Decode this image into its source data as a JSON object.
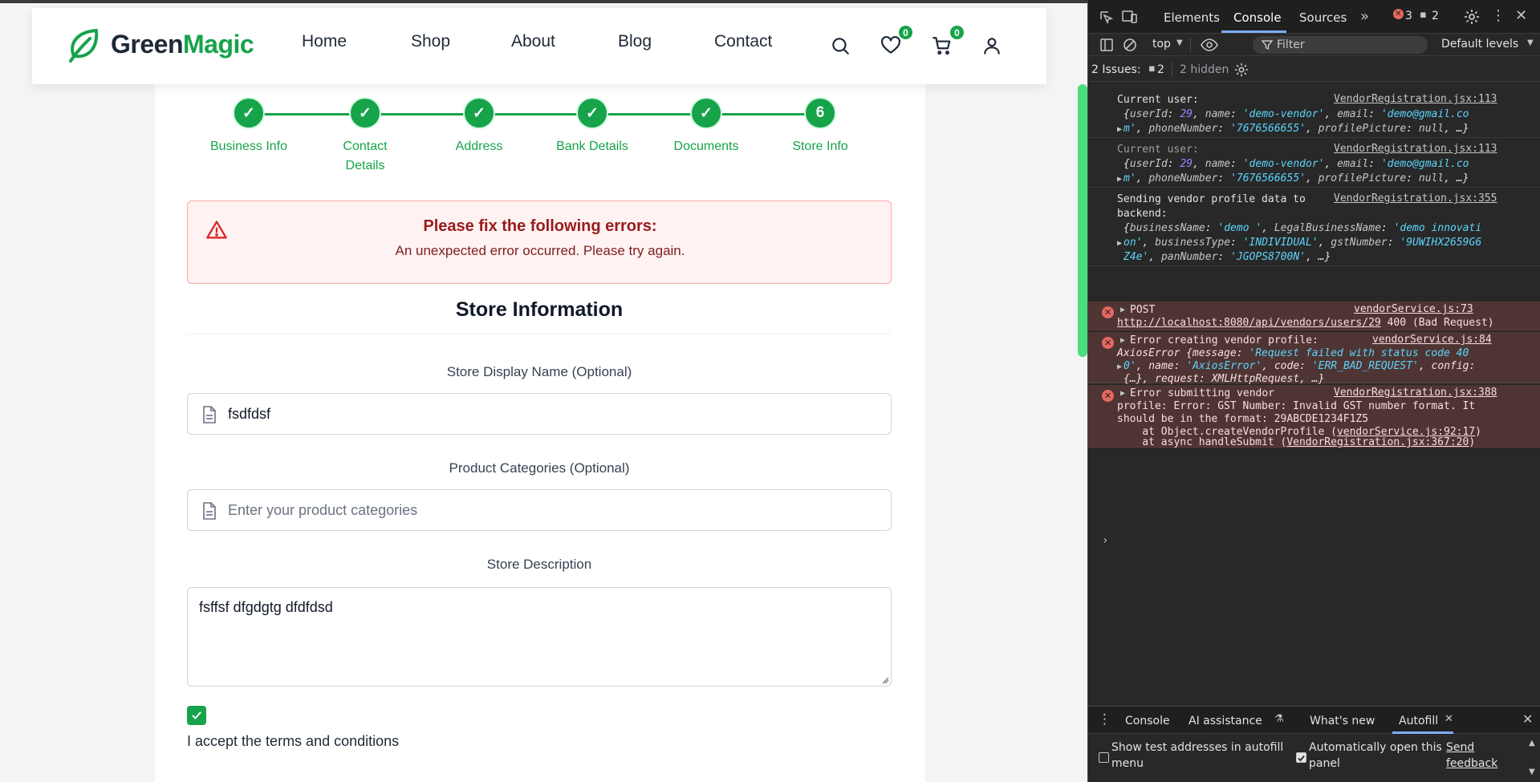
{
  "header": {
    "brand_part1": "Green",
    "brand_part2": "Magic",
    "nav": [
      "Home",
      "Shop",
      "About",
      "Blog",
      "Contact"
    ],
    "wishlist_count": "0",
    "cart_count": "0"
  },
  "stepper": {
    "steps": [
      {
        "label": "Business Info",
        "marker": "✓"
      },
      {
        "label": "Contact Details",
        "marker": "✓"
      },
      {
        "label": "Address",
        "marker": "✓"
      },
      {
        "label": "Bank Details",
        "marker": "✓"
      },
      {
        "label": "Documents",
        "marker": "✓"
      },
      {
        "label": "Store Info",
        "marker": "6"
      }
    ]
  },
  "error": {
    "title": "Please fix the following errors:",
    "message": "An unexpected error occurred. Please try again."
  },
  "form": {
    "section_title": "Store Information",
    "display_name_label": "Store Display Name (Optional)",
    "display_name_value": "fsdfdsf",
    "categories_label": "Product Categories (Optional)",
    "categories_placeholder": "Enter your product categories",
    "categories_value": "",
    "description_label": "Store Description",
    "description_value": "fsffsf dfgdgtg dfdfdsd",
    "terms_label": "I accept the terms and conditions",
    "terms_checked": true
  },
  "devtools": {
    "tabs": [
      "Elements",
      "Console",
      "Sources"
    ],
    "active_tab": "Console",
    "error_count": "3",
    "message_count": "2",
    "context": "top",
    "filter_placeholder": "Filter",
    "levels": "Default levels",
    "issues_label": "2 Issues:",
    "issues_count": "2",
    "hidden_label": "2 hidden",
    "logs": {
      "log1_label": "Current user:",
      "log1_src": "VendorRegistration.jsx:113",
      "log2_label": "Current user:",
      "log2_src": "VendorRegistration.jsx:113",
      "log3_label1": "Sending vendor profile data to",
      "log3_label2": "backend:",
      "log3_src": "VendorRegistration.jsx:355",
      "err1_label": "POST",
      "err1_src": "vendorService.js:73",
      "err1_url": "http://localhost:8080/api/vendors/users/29",
      "err1_status": " 400 (Bad Request)",
      "err2_label": "Error creating vendor profile:",
      "err2_src": "vendorService.js:84",
      "err3_label": "Error submitting vendor",
      "err3_src": "VendorRegistration.jsx:388",
      "err3_l2": "profile: Error: GST Number: Invalid GST number format. It",
      "err3_l3": "should be in the format: 29ABCDE1234F1Z5",
      "err3_l4_pre": "    at Object.createVendorProfile (",
      "err3_l4_link": "vendorService.js:92:17",
      "err3_l5_pre": "    at async handleSubmit (",
      "err3_l5_link": "VendorRegistration.jsx:367:20"
    },
    "drawer": {
      "tabs": [
        "Console",
        "AI assistance",
        "What's new",
        "Autofill"
      ],
      "active_tab": "Autofill",
      "opt1": [
        "Show test addresses in autofill",
        "menu"
      ],
      "opt1_checked": false,
      "opt2": [
        "Automatically open this",
        "panel"
      ],
      "opt2_checked": true,
      "feedback": [
        "Send",
        "feedback"
      ]
    }
  }
}
